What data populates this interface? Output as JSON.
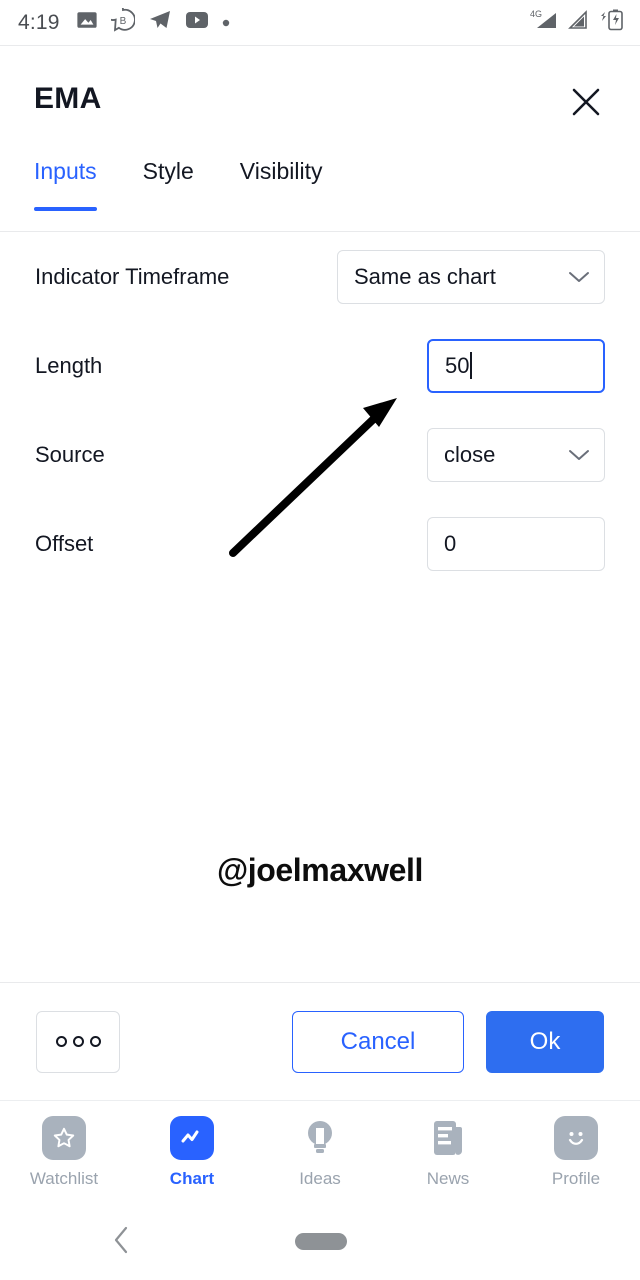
{
  "status_bar": {
    "time": "4:19",
    "left_icons": [
      "gallery-icon",
      "messenger-b-icon",
      "telegram-icon",
      "youtube-icon",
      "dot-icon"
    ],
    "network_label": "4G",
    "right_icons": [
      "signal-4g-icon",
      "signal-icon",
      "battery-charging-icon"
    ]
  },
  "dialog": {
    "title": "EMA",
    "close_label": "close-icon",
    "tabs": [
      {
        "label": "Inputs",
        "active": true
      },
      {
        "label": "Style",
        "active": false
      },
      {
        "label": "Visibility",
        "active": false
      }
    ],
    "fields": [
      {
        "label": "Indicator Timeframe",
        "type": "select",
        "value": "Same as chart"
      },
      {
        "label": "Length",
        "type": "input",
        "value": "50",
        "focused": true
      },
      {
        "label": "Source",
        "type": "select",
        "value": "close"
      },
      {
        "label": "Offset",
        "type": "input",
        "value": "0",
        "focused": false
      }
    ],
    "footer": {
      "more_label": "more-options",
      "cancel_label": "Cancel",
      "ok_label": "Ok"
    }
  },
  "watermark": {
    "text": "@joelmaxwell"
  },
  "bottom_nav": [
    {
      "label": "Watchlist",
      "icon": "star-icon",
      "active": false
    },
    {
      "label": "Chart",
      "icon": "chart-line-icon",
      "active": true
    },
    {
      "label": "Ideas",
      "icon": "lightbulb-icon",
      "active": false
    },
    {
      "label": "News",
      "icon": "news-document-icon",
      "active": false
    },
    {
      "label": "Profile",
      "icon": "smiley-face-icon",
      "active": false
    }
  ],
  "system_nav": {
    "back": "back-chevron-icon",
    "home": "home-pill-indicator"
  },
  "colors": {
    "accent": "#2962ff",
    "ok_button": "#2e6ef0",
    "text": "#131722",
    "muted": "#9aa3ae",
    "border": "#dcdfe3"
  }
}
